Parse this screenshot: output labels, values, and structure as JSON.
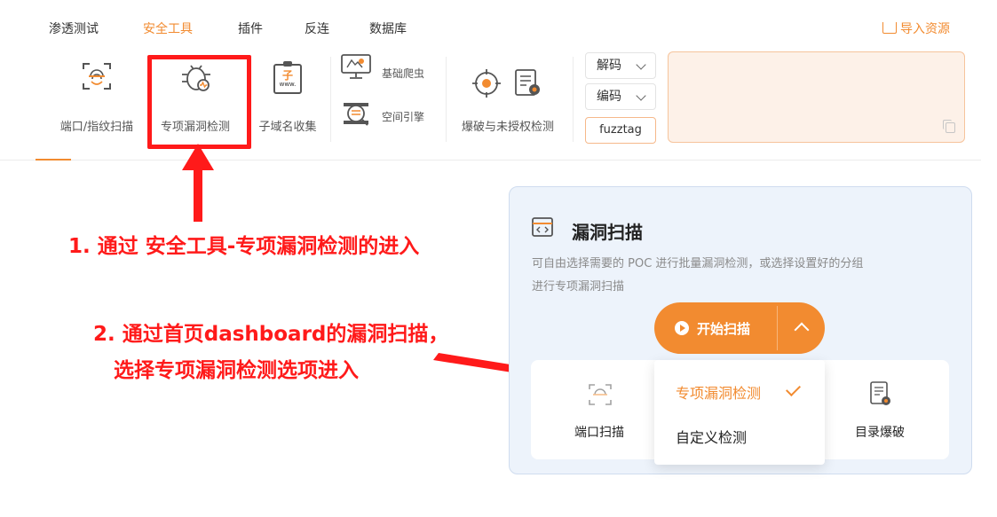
{
  "menu": {
    "items": [
      {
        "label": "渗透测试"
      },
      {
        "label": "安全工具"
      },
      {
        "label": "插件"
      },
      {
        "label": "反连"
      },
      {
        "label": "数据库"
      }
    ],
    "import_label": "导入资源"
  },
  "toolbar": {
    "port_scan": "端口/指纹扫描",
    "special_vuln": "专项漏洞检测",
    "subdomain": "子域名收集",
    "crawler": "基础爬虫",
    "space_engine": "空间引擎",
    "brute_unauth": "爆破与未授权检测",
    "decode_label": "解码",
    "encode_label": "编码",
    "fuzztag_label": "fuzztag",
    "subdomain_icon_text": "子",
    "subdomain_icon_www": "www."
  },
  "annotations": {
    "step1": "1. 通过 安全工具-专项漏洞检测的进入",
    "step2_line1": "2. 通过首页dashboard的漏洞扫描，",
    "step2_line2": "选择专项漏洞检测选项进入"
  },
  "dashboard": {
    "title": "漏洞扫描",
    "desc_line1": "可自由选择需要的 POC 进行批量漏洞检测，或选择设置好的分组",
    "desc_line2": "进行专项漏洞扫描",
    "start_button": "开始扫描",
    "dropdown_options": [
      {
        "label": "专项漏洞检测"
      },
      {
        "label": "自定义检测"
      }
    ],
    "port_scan": "端口扫描",
    "dir_brute": "目录爆破"
  },
  "colors": {
    "accent": "#f28b30",
    "annotation_red": "#ff1a1a",
    "card_bg": "#edf3fb"
  }
}
